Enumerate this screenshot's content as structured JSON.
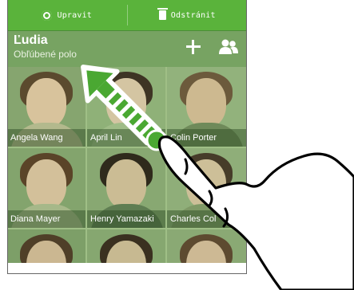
{
  "dropbar": {
    "edit_label": "Upravit",
    "remove_label": "Odstránit"
  },
  "header": {
    "title": "Ľudia",
    "subtitle": "Obľúbené polo"
  },
  "contacts": [
    {
      "name": "Angela Wang"
    },
    {
      "name": "April Lin"
    },
    {
      "name": "Colin Porter"
    },
    {
      "name": "Diana Mayer"
    },
    {
      "name": "Henry Yamazaki"
    },
    {
      "name": "Charles Col"
    },
    {
      "name": ""
    },
    {
      "name": ""
    },
    {
      "name": ""
    }
  ],
  "colors": {
    "dropbar": "#5ab33b",
    "arrow": "#4aa832",
    "overlay_tint": "#9fbf86"
  }
}
